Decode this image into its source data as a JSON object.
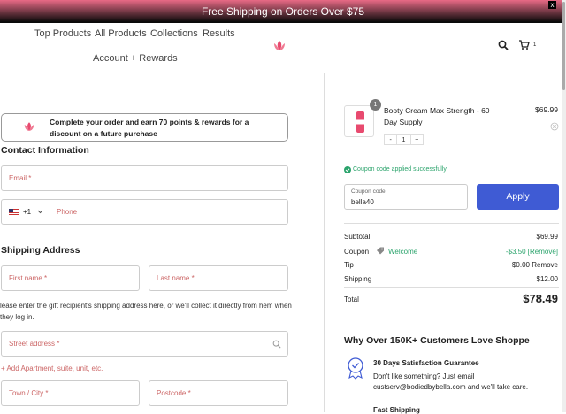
{
  "banner": {
    "text": "Free Shipping on Orders Over $75",
    "close": "x"
  },
  "nav": {
    "links": [
      "Top Products",
      "All Products",
      "Collections",
      "Results"
    ],
    "account": "Account + Rewards",
    "cart_count": "1"
  },
  "promo": {
    "text": "Complete your order and earn 70 points & rewards for a discount on a future purchase"
  },
  "contact": {
    "heading": "Contact Information",
    "email_placeholder": "Email *",
    "phone_code": "+1",
    "phone_placeholder": "Phone"
  },
  "shipping": {
    "heading": "Shipping Address",
    "first_name": "First name *",
    "last_name": "Last name *",
    "note": "lease enter the gift recipient's shipping address here, or we'll collect it directly from hem when they log in.",
    "street": "Street address *",
    "add_apt": "+ Add Apartment, suite, unit, etc.",
    "town": "Town / City *",
    "postcode": "Postcode *"
  },
  "cart": {
    "item_badge": "1",
    "item_name": "Booty Cream Max Strength - 60 Day Supply",
    "item_price": "$69.99",
    "qty_minus": "-",
    "qty": "1",
    "qty_plus": "+"
  },
  "coupon": {
    "success": "Coupon code applied successfully.",
    "label": "Coupon code",
    "value": "bella40",
    "apply": "Apply"
  },
  "summary": {
    "subtotal_label": "Subtotal",
    "subtotal": "$69.99",
    "coupon_label": "Coupon",
    "coupon_name": "Welcome",
    "coupon_value": "-$3.50 [Remove]",
    "tip_label": "Tip",
    "tip": "$0.00 Remove",
    "shipping_label": "Shipping",
    "shipping": "$12.00",
    "total_label": "Total",
    "total": "$78.49"
  },
  "why": {
    "heading": "Why Over 150K+ Customers Love Shoppe",
    "guarantee_title": "30 Days Satisfaction Guarantee",
    "guarantee_text": "Don't like something? Just email custserv@bodiedbybella.com and we'll take care.",
    "fast_title": "Fast Shipping"
  },
  "colors": {
    "accent": "#3f5bd4",
    "brand": "#e84a6f",
    "success": "#2aa36b"
  }
}
